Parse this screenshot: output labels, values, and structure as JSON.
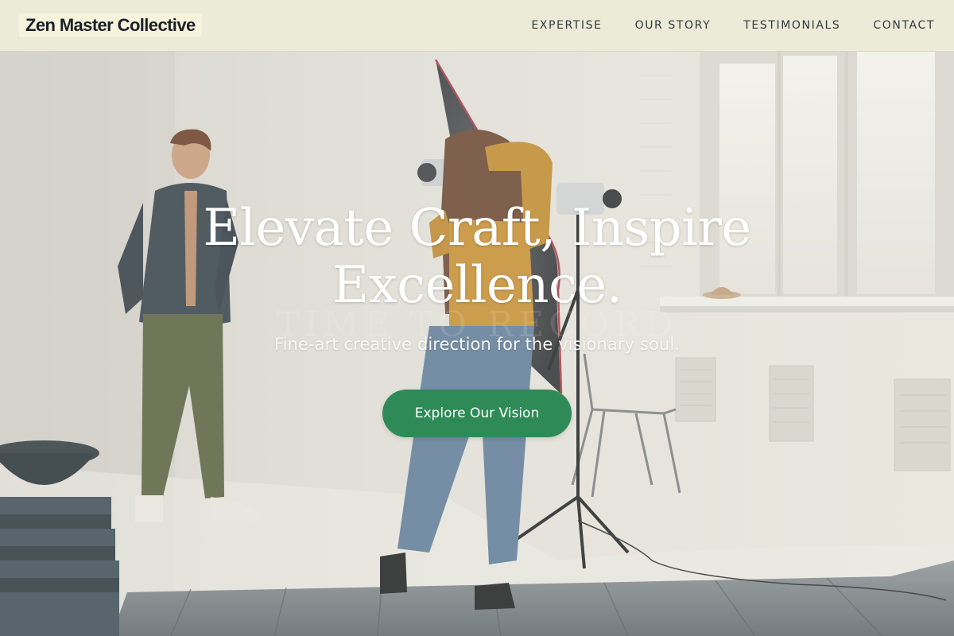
{
  "header": {
    "logo": "Zen Master Collective",
    "nav": [
      "EXPERTISE",
      "OUR STORY",
      "TESTIMONIALS",
      "CONTACT"
    ]
  },
  "hero": {
    "headline_line1": "Elevate Craft, Inspire",
    "headline_line2": "Excellence.",
    "subheadline": "Fine-art creative direction for the visionary soul.",
    "cta_label": "Explore Our Vision",
    "background_image": "photo-studio-photographer-shooting-model"
  },
  "colors": {
    "header_bg": "#ecebd8",
    "logo_bg": "#f6f3dc",
    "nav_text": "#33383d",
    "cta_bg": "#2e8b57",
    "headline": "#ffffff"
  }
}
